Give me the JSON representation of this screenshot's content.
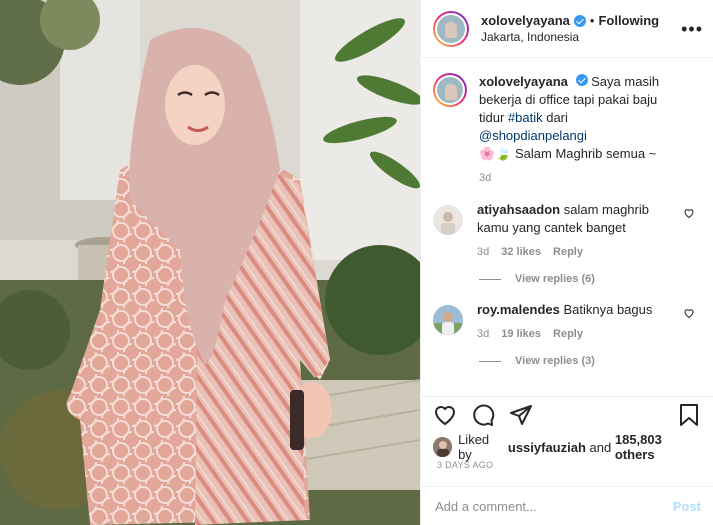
{
  "post": {
    "author": "xolovelyayana",
    "follow_status": "Following",
    "separator": "•",
    "location": "Jakarta, Indonesia",
    "more_glyph": "•••"
  },
  "caption": {
    "username": "xolovelyayana",
    "text_before": "Saya masih bekerja di office tapi pakai baju tidur ",
    "hashtag": "#batik",
    "text_mid": " dari ",
    "mention": "@shopdianpelangi",
    "emojis": "🌸🍃",
    "text_end": " Salam Maghrib semua ~",
    "time": "3d"
  },
  "comments": [
    {
      "username": "atiyahsaadon",
      "text": "salam maghrib kamu yang cantek banget",
      "time": "3d",
      "likes": "32 likes",
      "reply_label": "Reply",
      "view_replies": "View replies (6)"
    },
    {
      "username": "roy.malendes",
      "text": "Batiknya bagus",
      "time": "3d",
      "likes": "19 likes",
      "reply_label": "Reply",
      "view_replies": "View replies (3)"
    }
  ],
  "likes": {
    "prefix": "Liked by",
    "user": "ussiyfauziah",
    "middle": "and",
    "count": "185,803 others"
  },
  "timestamp": "3 DAYS AGO",
  "add_comment": {
    "placeholder": "Add a comment...",
    "post_label": "Post"
  },
  "icons": {
    "header_avatar": "profile-avatar",
    "verified": "verified-badge-icon",
    "like": "heart-icon",
    "comment": "comment-icon",
    "share": "share-icon",
    "save": "bookmark-icon",
    "comment_like": "small-heart-icon"
  },
  "colors": {
    "link": "#00376b",
    "verified": "#3897f0",
    "post_button_disabled": "#b2dffc",
    "muted_text": "#8e8e8e"
  }
}
